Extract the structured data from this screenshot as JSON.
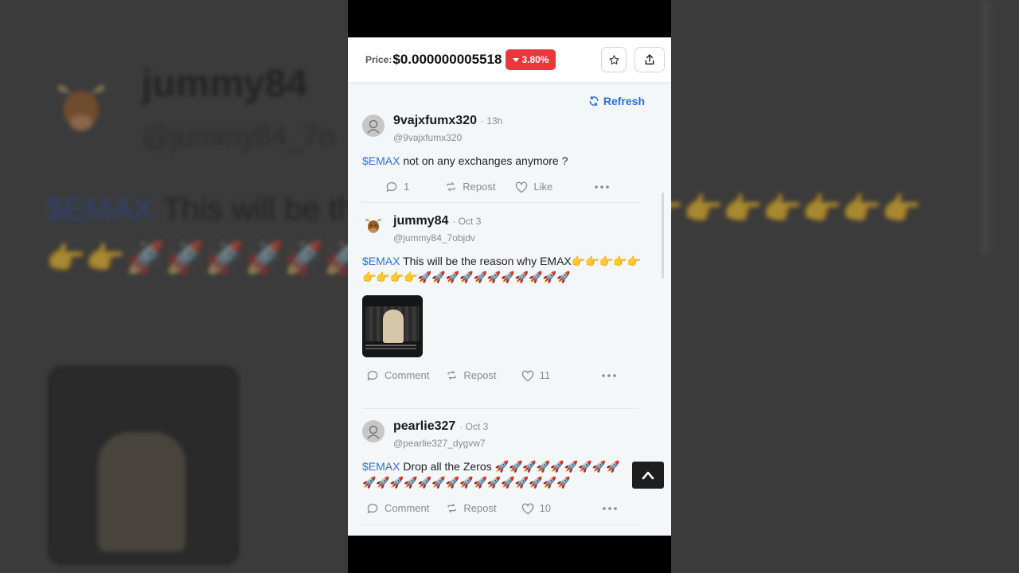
{
  "background": {
    "name": "jummy84",
    "handle": "@jummy84_7o",
    "ticker": "$EMAX",
    "text": " This will be the reason why EMAX👉👉👉👉👉👉👉👉👉🚀🚀🚀🚀🚀🚀🚀🚀🚀🚀🚀"
  },
  "header": {
    "price_label": "Price:",
    "price_value": "$0.000000005518",
    "change": "3.80%",
    "change_color": "#e8383d"
  },
  "refresh_label": "Refresh",
  "posts": [
    {
      "username": "9vajxfumx320",
      "time": "· 13h",
      "handle": "@9vajxfumx320",
      "ticker": "$EMAX",
      "text": " not on any exchanges anymore ?",
      "comment_label": "1",
      "repost_label": "Repost",
      "like_label": "Like"
    },
    {
      "username": "jummy84",
      "time": "· Oct 3",
      "handle": "@jummy84_7objdv",
      "ticker": "$EMAX",
      "text": " This will be the reason why EMAX👉👉👉👉👉👉👉👉👉🚀🚀🚀🚀🚀🚀🚀🚀🚀🚀🚀",
      "comment_label": "Comment",
      "repost_label": "Repost",
      "like_label": "11"
    },
    {
      "username": "pearlie327",
      "time": "· Oct 3",
      "handle": "@pearlie327_dygvw7",
      "ticker": "$EMAX",
      "text": " Drop all the Zeros 🚀🚀🚀🚀🚀🚀🚀🚀🚀🚀🚀🚀🚀🚀🚀🚀🚀🚀🚀🚀🚀🚀🚀🚀",
      "comment_label": "Comment",
      "repost_label": "Repost",
      "like_label": "10"
    }
  ],
  "accent_color": "#2f6fe0"
}
